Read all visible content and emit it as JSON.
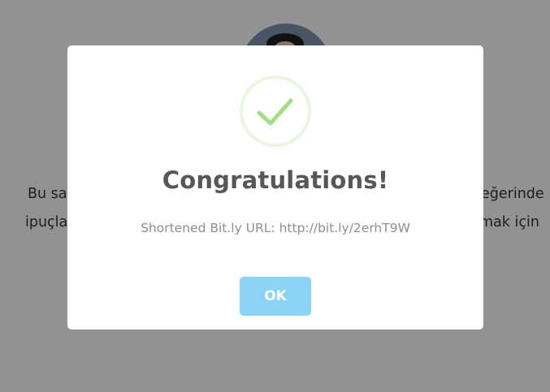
{
  "background": {
    "line_left_1": "Bu sa",
    "line_left_2": "ipuçla",
    "line_right_1": "eğerinde",
    "line_right_2": "mak için"
  },
  "modal": {
    "icon": "checkmark-icon",
    "title": "Congratulations!",
    "message": "Shortened Bit.ly URL: http://bit.ly/2erhT9W",
    "ok_label": "OK"
  },
  "colors": {
    "overlay": "#9a9a9a",
    "success_icon_stroke": "#a5dc86",
    "success_icon_ring": "#e9f6e0",
    "button_bg": "#8cd4f5",
    "title_text": "#575757",
    "message_text": "#8f8f8f"
  }
}
